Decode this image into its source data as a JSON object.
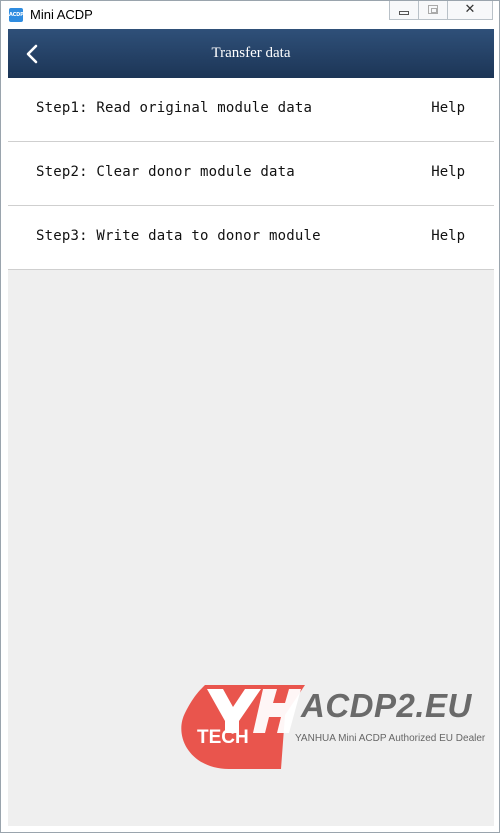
{
  "window": {
    "title": "Mini ACDP",
    "icon_text": "ACDP",
    "controls": {
      "minimize": "minimize",
      "maximize": "maximize",
      "close": "✕"
    }
  },
  "header": {
    "title": "Transfer data",
    "back_icon": "chevron-left-icon"
  },
  "steps": [
    {
      "label": "Step1: Read original module data",
      "help": "Help"
    },
    {
      "label": "Step2: Clear donor module data",
      "help": "Help"
    },
    {
      "label": "Step3: Write data to donor module",
      "help": "Help"
    }
  ],
  "watermark": {
    "logo_letters": "YH",
    "tech": "TECH",
    "brand": "ACDP2.EU",
    "tagline": "YANHUA Mini ACDP Authorized EU Dealer"
  },
  "colors": {
    "header_bg": "#1f3a5f",
    "content_bg": "#efefef",
    "watermark_red": "#e8483f"
  }
}
